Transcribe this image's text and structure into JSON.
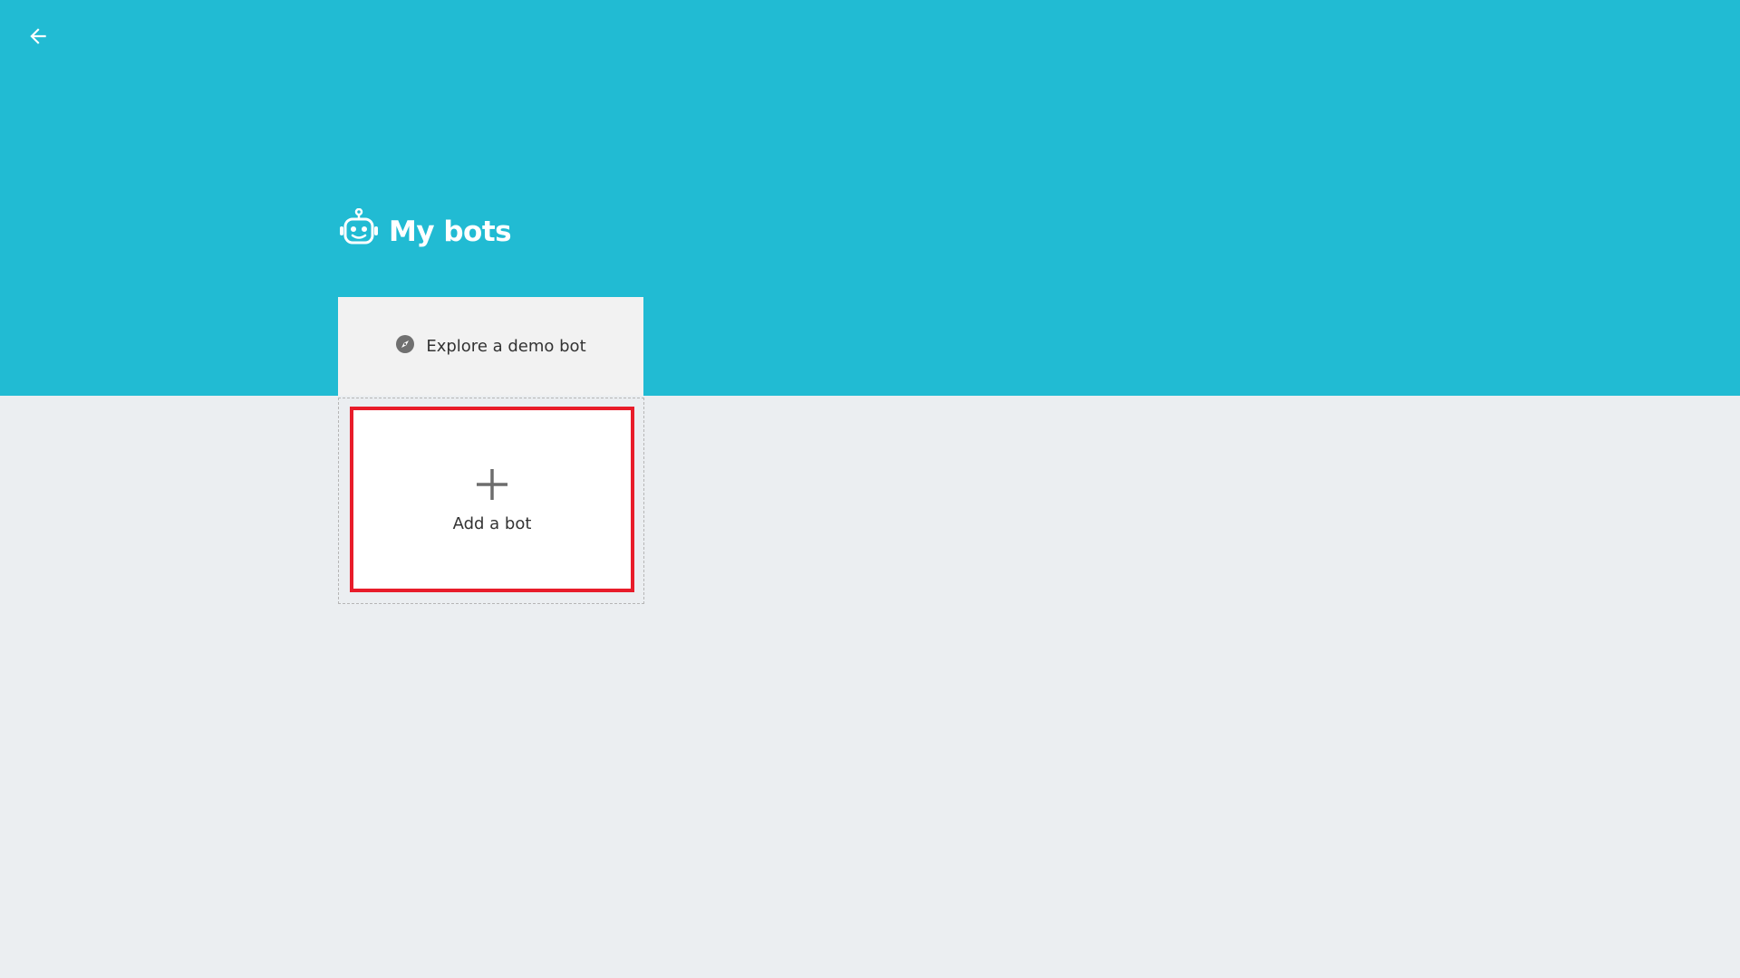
{
  "header": {
    "title": "My bots",
    "title_icon": "robot-icon",
    "back_icon": "arrow-left-icon",
    "background_color": "#21bbd3"
  },
  "cards": {
    "demo": {
      "label": "Explore a demo bot",
      "icon": "compass-icon"
    },
    "add": {
      "label": "Add a bot",
      "icon": "plus-icon",
      "highlight_color": "#e81c2a"
    }
  }
}
